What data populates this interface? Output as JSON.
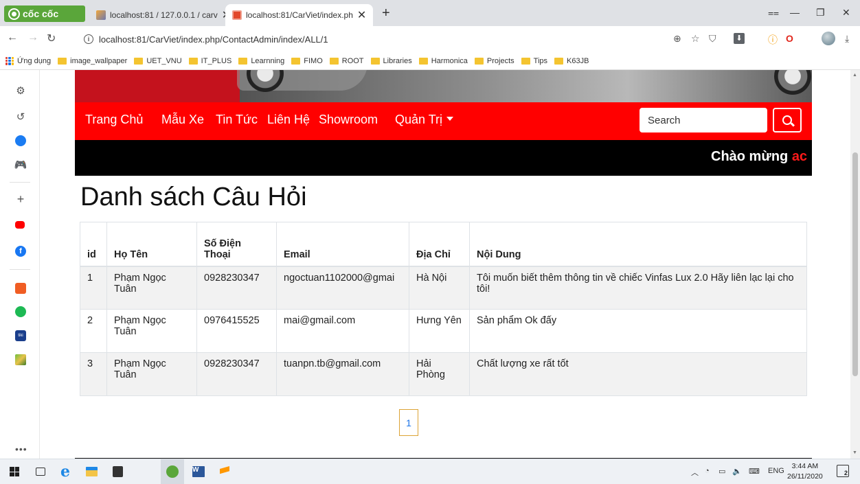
{
  "browser": {
    "brand": "cốc cốc",
    "tabs": [
      {
        "title": "localhost:81 / 127.0.0.1 / carv"
      },
      {
        "title": "localhost:81/CarViet/index.ph"
      }
    ],
    "new_tab": "+",
    "url": "localhost:81/CarViet/index.php/ContactAdmin/index/ALL/1",
    "bookmarks": [
      "Ứng dụng",
      "image_wallpaper",
      "UET_VNU",
      "IT_PLUS",
      "Learnning",
      "FIMO",
      "ROOT",
      "Libraries",
      "Harmonica",
      "Projects",
      "Tips",
      "K63JB"
    ]
  },
  "site": {
    "nav": {
      "items": [
        "Trang Chủ",
        "Mẫu Xe",
        "Tin Tức",
        "Liên Hệ",
        "Showroom",
        "Quản Trị"
      ],
      "search_placeholder": "Search"
    },
    "marquee": {
      "text": "Chào mừng ",
      "accent": "ac"
    },
    "page_title": "Danh sách Câu Hỏi",
    "table": {
      "headers": [
        "id",
        "Họ Tên",
        "Số Điện Thoại",
        "Email",
        "Địa Chỉ",
        "Nội Dung"
      ],
      "rows": [
        [
          "1",
          "Phạm Ngọc Tuân",
          "0928230347",
          "ngoctuan1102000@gmai",
          "Hà Nội",
          "Tôi muốn biết thêm thông tin về chiếc Vinfas Lux 2.0 Hãy liên lạc lại cho tôi!"
        ],
        [
          "2",
          "Phạm Ngọc Tuân",
          "0976415525",
          "mai@gmail.com",
          "Hưng Yên",
          "Sản phẩm Ok đấy"
        ],
        [
          "3",
          "Phạm Ngọc Tuân",
          "0928230347",
          "tuanpn.tb@gmail.com",
          "Hải Phòng",
          "Chất lượng xe rất tốt"
        ]
      ]
    },
    "pagination": {
      "current": "1"
    }
  },
  "taskbar": {
    "lang": "ENG",
    "time": "3:44 AM",
    "date": "26/11/2020",
    "notifications": "2"
  },
  "colors": {
    "nav_red": "#ff0000",
    "banner_red": "#c4121d",
    "marquee_bg": "#000000",
    "coccoc_green": "#5aa63a"
  }
}
